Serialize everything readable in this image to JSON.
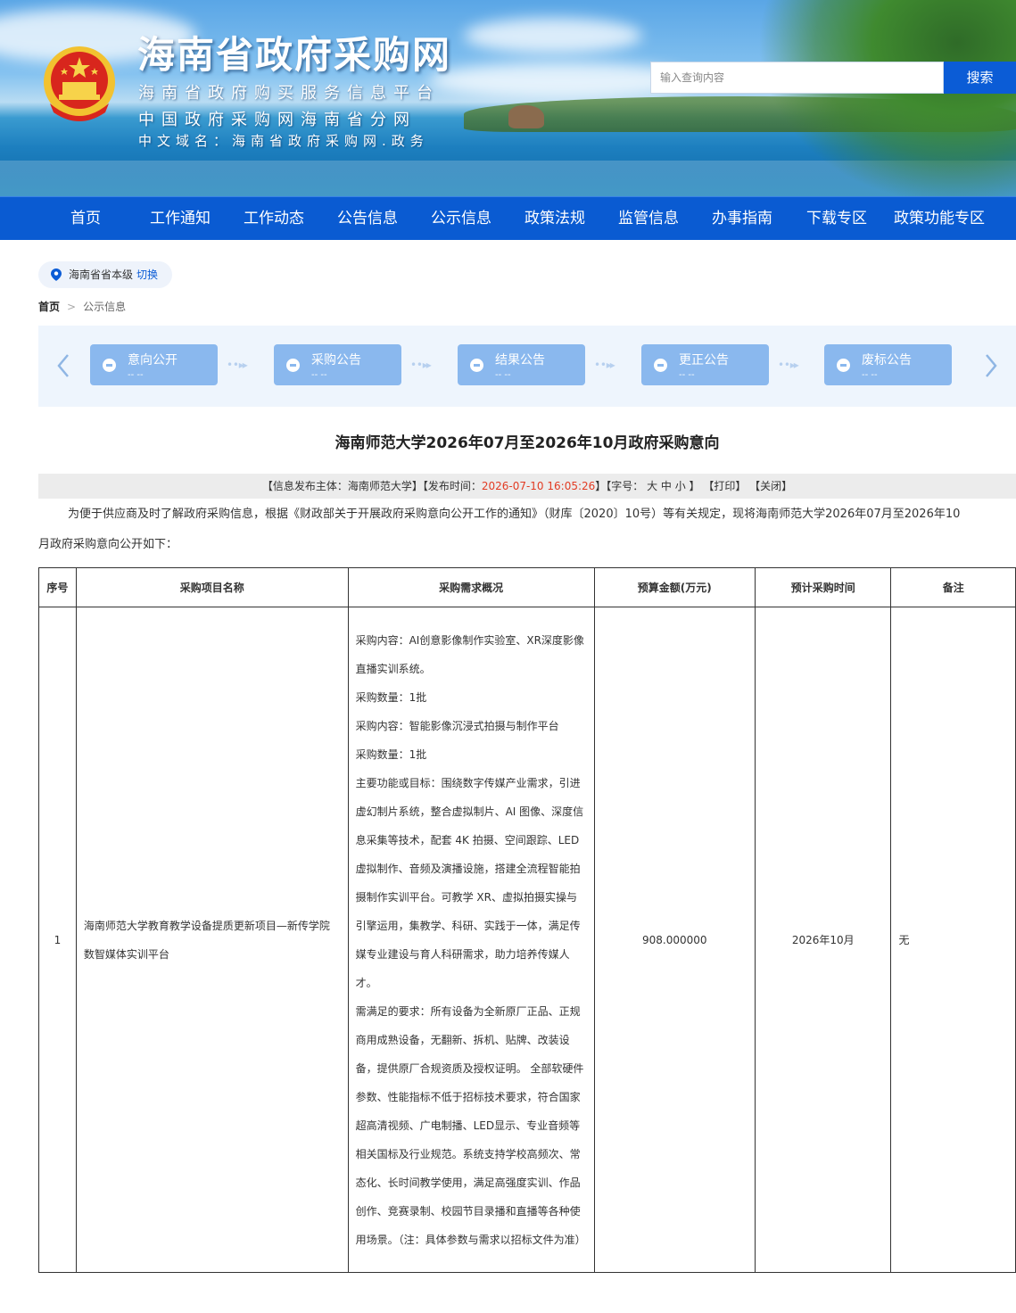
{
  "header": {
    "site_title": "海南省政府采购网",
    "subtitle_1": "海南省政府购买服务信息平台",
    "subtitle_2": "中国政府采购网海南省分网",
    "subtitle_3": "中文域名：海南省政府采购网.政务",
    "search_placeholder": "输入查询内容",
    "search_button": "搜索"
  },
  "nav": [
    "首页",
    "工作通知",
    "工作动态",
    "公告信息",
    "公示信息",
    "政策法规",
    "监管信息",
    "办事指南",
    "下载专区",
    "政策功能专区"
  ],
  "region": {
    "name": "海南省省本级",
    "switch": "切换"
  },
  "breadcrumb": {
    "home": "首页",
    "sep": ">",
    "current": "公示信息"
  },
  "steps": [
    {
      "label": "意向公开",
      "sub": "-- --"
    },
    {
      "label": "采购公告",
      "sub": "-- --"
    },
    {
      "label": "结果公告",
      "sub": "-- --"
    },
    {
      "label": "更正公告",
      "sub": "-- --"
    },
    {
      "label": "废标公告",
      "sub": "-- --"
    }
  ],
  "article": {
    "title": "海南师范大学2026年07月至2026年10月政府采购意向",
    "meta_prefix": "【信息发布主体：海南师范大学】【发布时间：",
    "meta_time": "2026-07-10 16:05:26",
    "meta_suffix": "】【字号： 大 中 小 】 【打印】 【关闭】",
    "intro_line1": "为便于供应商及时了解政府采购信息，根据《财政部关于开展政府采购意向公开工作的通知》（财库〔2020〕10号）等有关规定，现将海南师范大学2026年07月至2026年10",
    "intro_line2": "月政府采购意向公开如下："
  },
  "table": {
    "headers": [
      "序号",
      "采购项目名称",
      "采购需求概况",
      "预算金额(万元)",
      "预计采购时间",
      "备注"
    ],
    "rows": [
      {
        "no": "1",
        "name": "海南师范大学教育教学设备提质更新项目—新传学院数智媒体实训平台",
        "desc": [
          "采购内容：AI创意影像制作实验室、XR深度影像直播实训系统。",
          "采购数量：1批",
          "采购内容：智能影像沉浸式拍摄与制作平台",
          "采购数量：1批",
          "主要功能或目标：围绕数字传媒产业需求，引进虚幻制片系统，整合虚拟制片、AI 图像、深度信息采集等技术，配套 4K 拍摄、空间跟踪、LED 虚拟制作、音频及演播设施，搭建全流程智能拍摄制作实训平台。可教学 XR、虚拟拍摄实操与引擎运用，集教学、科研、实践于一体，满足传媒专业建设与育人科研需求，助力培养传媒人才。",
          "需满足的要求：所有设备为全新原厂正品、正规商用成熟设备，无翻新、拆机、贴牌、改装设备，提供原厂合规资质及授权证明。 全部软硬件参数、性能指标不低于招标技术要求，符合国家超高清视频、广电制播、LED显示、专业音频等相关国标及行业规范。系统支持学校高频次、常态化、长时间教学使用，满足高强度实训、作品创作、竞赛录制、校园节目录播和直播等各种使用场景。（注：具体参数与需求以招标文件为准）"
        ],
        "budget": "908.000000",
        "time": "2026年10月",
        "note": "无"
      }
    ]
  },
  "colors": {
    "nav_bg": "#0a5bd2",
    "search_btn": "#0b5cd6",
    "step_bg": "#8ab8ee",
    "time_red": "#e23c24"
  }
}
